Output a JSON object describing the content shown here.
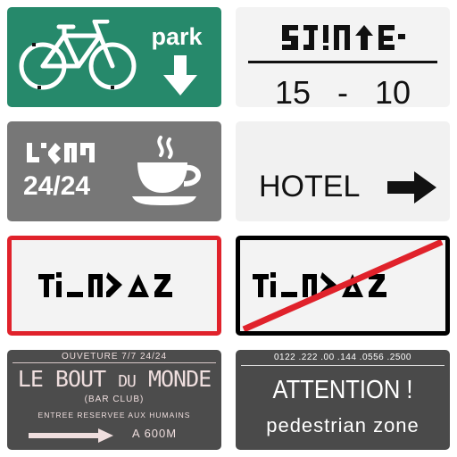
{
  "colors": {
    "park_bg": "#26896b",
    "light_bg": "#f3f3f3",
    "grey_bg": "#777777",
    "dark_bg": "#4c4c4c",
    "red_border": "#e0222b",
    "black": "#000000"
  },
  "signs": {
    "park": {
      "label": "park",
      "icons": [
        "bicycle-icon",
        "arrow-down-icon"
      ]
    },
    "times": {
      "start": "15",
      "separator": "-",
      "end": "10"
    },
    "cafe": {
      "hours": "24/24",
      "icons": [
        "coffee-cup-icon"
      ]
    },
    "hotel": {
      "label": "HOTEL",
      "icons": [
        "arrow-right-icon"
      ]
    },
    "entry": {
      "border": "red"
    },
    "exit": {
      "border": "black",
      "crossed": true
    },
    "bar": {
      "hours": "OUVETURE 7/7 24/24",
      "title_a": "LE BOUT ",
      "title_b": "DU",
      "title_c": " MONDE",
      "club": "(BAR CLUB)",
      "note": "ENTREE RESERVEE AUX HUMAINS",
      "distance": "A   600M"
    },
    "attention": {
      "phone": "0122 .222 .00 .144 .0556 .2500",
      "headline": "ATTENTION !",
      "sub": "pedestrian zone"
    }
  }
}
